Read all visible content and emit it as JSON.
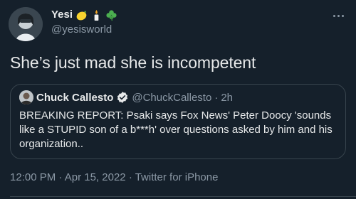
{
  "author": {
    "display_name": "Yesi",
    "handle": "@yesisworld",
    "name_emojis": [
      "lemon-icon",
      "candle-icon",
      "shamrock-icon"
    ]
  },
  "tweet": {
    "text": "She’s just mad she is incompetent"
  },
  "quoted_tweet": {
    "name": "Chuck Callesto",
    "handle": "@ChuckCallesto",
    "separator": "·",
    "time": "2h",
    "text": "BREAKING REPORT: Psaki says Fox News' Peter Doocy 'sounds like a STUPID son of a b***h' over questions asked by him and his organization.."
  },
  "meta": {
    "time": "12:00 PM",
    "separator1": "·",
    "date": "Apr 15, 2022",
    "separator2": "·",
    "source": "Twitter for iPhone"
  },
  "colors": {
    "background": "#15202b",
    "text_primary": "#e7e9ea",
    "text_secondary": "#8b98a5",
    "border": "#38444d",
    "verified": "#1d9bf0"
  }
}
